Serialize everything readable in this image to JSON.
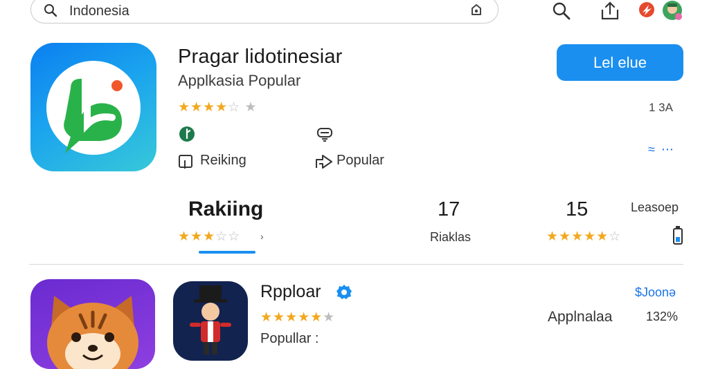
{
  "search": {
    "query": "Indonesia"
  },
  "app1": {
    "title": "Pragar lidotinesiar",
    "subtitle": "Applkasia Popular",
    "rating_stars": 4.5,
    "install_label": "Lel elue",
    "size": "1 3A",
    "chip1": "Reiking",
    "chip2": "Popular",
    "more": "≈ ⋯"
  },
  "stats": {
    "ranking_label": "Rakiing",
    "ranking_arrow": "›",
    "count": "17",
    "count_label": "Riaklas",
    "rating": "15",
    "rating_label": "Leasoep"
  },
  "app2": {
    "title": "Rpploar",
    "rating_stars": 4.5,
    "subtitle": "Popullar :",
    "developer": "Applnalaa",
    "size": "132%",
    "price": "$Joonə"
  },
  "colors": {
    "accent": "#1a8ff0",
    "star": "#f2a81d"
  }
}
